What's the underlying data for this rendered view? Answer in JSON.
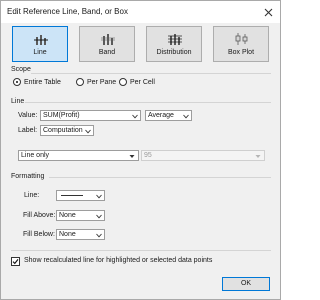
{
  "dialog": {
    "title": "Edit Reference Line, Band, or Box"
  },
  "types": [
    {
      "label": "Line",
      "icon": "reference-line-icon",
      "selected": true
    },
    {
      "label": "Band",
      "icon": "reference-band-icon",
      "selected": false
    },
    {
      "label": "Distribution",
      "icon": "distribution-icon",
      "selected": false
    },
    {
      "label": "Box Plot",
      "icon": "box-plot-icon",
      "selected": false
    }
  ],
  "scope": {
    "heading": "Scope",
    "options": [
      {
        "label": "Entire Table",
        "checked": true
      },
      {
        "label": "Per Pane",
        "checked": false
      },
      {
        "label": "Per Cell",
        "checked": false
      }
    ]
  },
  "line": {
    "heading": "Line",
    "value_label": "Value:",
    "value_field": "SUM(Profit)",
    "aggregation": "Average",
    "label_label": "Label:",
    "label_value": "Computation",
    "confidence_mode": "Line only",
    "confidence_level": "95"
  },
  "formatting": {
    "heading": "Formatting",
    "line_label": "Line:",
    "fill_above_label": "Fill Above:",
    "fill_above_value": "None",
    "fill_below_label": "Fill Below:",
    "fill_below_value": "None"
  },
  "recalc": {
    "label": "Show recalculated line for highlighted or selected data points",
    "checked": true
  },
  "ok_label": "OK",
  "colors": {
    "accent": "#0078d7",
    "selected_bg": "#cce4f7",
    "button_bg": "#e1e1e1",
    "dialog_bg": "#f0f0f0"
  }
}
